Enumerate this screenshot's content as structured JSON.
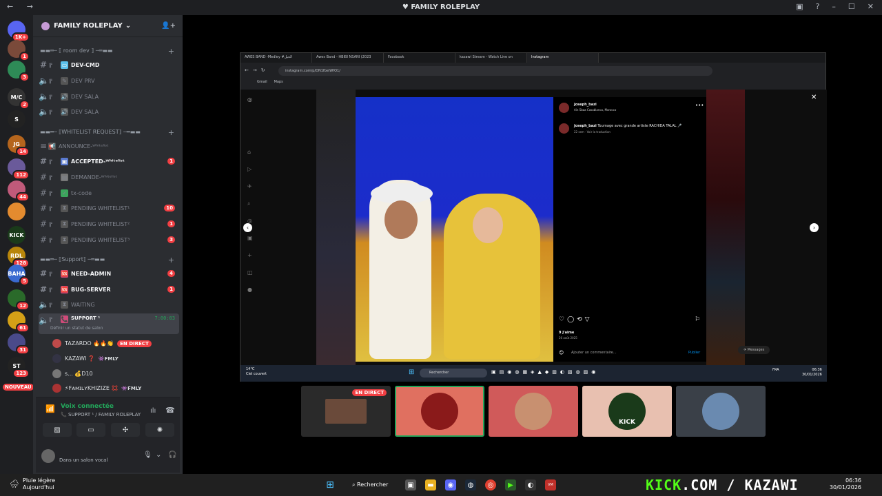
{
  "window": {
    "title": "FAMILY ROLEPLAY",
    "nav": "← →"
  },
  "server": {
    "name": "FAMILY ROLEPLAY"
  },
  "guilds": [
    {
      "label": "",
      "badge": "1K+",
      "color": "#5865f2"
    },
    {
      "label": "",
      "badge": "1",
      "color": "#7a4a3a"
    },
    {
      "label": "",
      "badge": "3",
      "color": "#2e8b57"
    },
    {
      "label": "M/C",
      "badge": "2",
      "color": "#333"
    },
    {
      "label": "S",
      "badge": "",
      "color": "#222"
    },
    {
      "label": "JG",
      "badge": "14",
      "color": "#b5651d"
    },
    {
      "label": "",
      "badge": "112",
      "color": "#6a5a9a"
    },
    {
      "label": "",
      "badge": "44",
      "color": "#c05a7a"
    },
    {
      "label": "",
      "badge": "",
      "color": "#e38b2f"
    },
    {
      "label": "KICK",
      "badge": "",
      "color": "#1a3a1a"
    },
    {
      "label": "RDL",
      "badge": "128",
      "color": "#b8860b"
    },
    {
      "label": "BAHA",
      "badge": "5",
      "color": "#3a6ad0"
    },
    {
      "label": "",
      "badge": "12",
      "color": "#2a6a2a"
    },
    {
      "label": "",
      "badge": "61",
      "color": "#d4a017"
    },
    {
      "label": "",
      "badge": "31",
      "color": "#4a4a8a"
    },
    {
      "label": "ST",
      "badge": "123",
      "color": "#222"
    }
  ],
  "nouveau": "NOUVEAU",
  "categories": [
    {
      "label": "▬▬═─ ⟦ room dev ⟧ ─═▬▬"
    },
    {
      "label": "▬▬═─ ⟦WHITELIST REQUEST⟧ ─═▬▬"
    },
    {
      "label": "▬▬═─ ⟦Support⟧ ─═▬▬"
    }
  ],
  "channels": [
    {
      "name": "DEV-CMD",
      "count": ""
    },
    {
      "name": "DEV PRV",
      "count": ""
    },
    {
      "name": "DEV SALA",
      "count": ""
    },
    {
      "name": "DEV SALA",
      "count": ""
    },
    {
      "name": "ANNOUNCE-ᵂʰⁱᵗᵉˡⁱˢᵗ",
      "count": ""
    },
    {
      "name": "ACCEPTED-ᵂʰⁱᵗᵉˡⁱˢᵗ",
      "count": "1"
    },
    {
      "name": "DEMANDE-ᵂʰⁱᵗᵉˡⁱˢᵗ",
      "count": ""
    },
    {
      "name": "tx-code",
      "count": ""
    },
    {
      "name": "PENDING WHITELIST¹",
      "count": "10"
    },
    {
      "name": "PENDING WHITELIST²",
      "count": "1"
    },
    {
      "name": "PENDING WHITELIST³",
      "count": "3"
    },
    {
      "name": "NEED-ADMIN",
      "count": "4"
    },
    {
      "name": "BUG-SERVER",
      "count": "1"
    },
    {
      "name": "WAITING",
      "count": ""
    }
  ],
  "support": {
    "name": "SUPPORT ¹",
    "time": "7:00:03",
    "status": "Définir un statut de salon"
  },
  "voice_users": [
    {
      "name": "TAZARDO 🔥🔥👏",
      "badge": "EN DIRECT"
    },
    {
      "name": "KAZAWI ❓",
      "badge": "👾FMLY"
    },
    {
      "name": "s... 💰D10",
      "badge": ""
    },
    {
      "name": "⚡FᴀᴍɪʟʏKHIZIZE 💢",
      "badge": "👾FMLY"
    }
  ],
  "voice": {
    "title": "Voix connectée",
    "sub": "📞 SUPPORT ¹ / FAMILY ROLEPLAY"
  },
  "panel": {
    "status": "Dans un salon vocal"
  },
  "browser": {
    "tabs": [
      "AWES BAND -Medley #الحيل",
      "Awes Band - HBIBI NSANI (2023",
      "Facebook",
      "kazawi Stream - Watch Live on",
      "Instagram"
    ],
    "url": "instagram.com/p/DN1fbeIWfO1/",
    "bookmarks": [
      "Gmail",
      "Maps"
    ],
    "post": {
      "username": "joseph_bazi",
      "location": "Ain Sbaa Casablanca, Morocco",
      "caption_user": "joseph_bazi",
      "caption": "Tournage avec grande artiste RACHIDA TALAL 🎤",
      "meta": "22 sem · Voir la traduction",
      "likes": "9 J'aime",
      "date": "26 août 2025",
      "comment_placeholder": "Ajouter un commentaire...",
      "publish": "Publier"
    },
    "taskbar": {
      "weather": "14°C",
      "weather2": "Ciel couvert",
      "search": "Rechercher",
      "lang": "FRA",
      "time": "06:36",
      "date": "30/01/2026"
    },
    "messages": "Messages"
  },
  "stream_tiles": [
    {
      "label": "EN DIRECT",
      "color": "#2a2a2a"
    },
    {
      "color": "#e07060"
    },
    {
      "color": "#d05a5a"
    },
    {
      "color": "#e8c0b0",
      "text": "KICK"
    },
    {
      "color": "#3a4048"
    }
  ],
  "taskbar": {
    "weather": "Pluie légère",
    "weather2": "Aujourd'hui",
    "search": "Rechercher",
    "kick": "KICK",
    "kick_rest": ".COM / KAZAWI",
    "time": "06:36",
    "date": "30/01/2026"
  },
  "colors": {
    "accent": "#5865f2",
    "danger": "#f23f43",
    "online": "#23a55a",
    "kick": "#53fc18"
  }
}
